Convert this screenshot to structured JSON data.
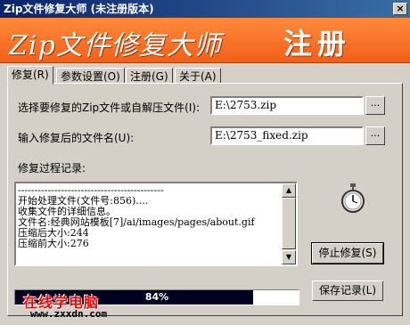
{
  "window": {
    "title": "Zip文件修复大师 (未注册版本)",
    "close_glyph": "×"
  },
  "banner": {
    "title": "Zip文件修复大师",
    "register_text": "注册"
  },
  "tabs": [
    {
      "label": "修复(R)"
    },
    {
      "label": "参数设置(O)"
    },
    {
      "label": "注册(G)"
    },
    {
      "label": "关于(A)"
    }
  ],
  "form": {
    "source_label": "选择要修复的Zip文件或自解压文件(I):",
    "source_value": "E:\\2753.zip",
    "output_label": "输入修复后的文件名(U):",
    "output_value": "E:\\2753_fixed.zip",
    "browse_label": "...",
    "log_label": "修复过程记录:"
  },
  "log": {
    "lines": [
      "--------------------------------------------",
      "开始处理文件(文件号:856)....",
      "收集文件的详细信息。",
      "文件名:经典网站模板[7]/ai/images/pages/about.gif",
      "压缩后大小:244",
      "压缩前大小:276"
    ]
  },
  "buttons": {
    "stop": "停止修复(S)",
    "save_log": "保存记录(L)"
  },
  "progress": {
    "value": 0.84,
    "text": "84%"
  },
  "watermark": {
    "line1": "在线学电脑",
    "line2": "www.zxxdn.com"
  },
  "icons": {
    "stopwatch": "stopwatch-icon",
    "scroll_up": "scroll-up-icon",
    "scroll_down": "scroll-down-icon"
  }
}
